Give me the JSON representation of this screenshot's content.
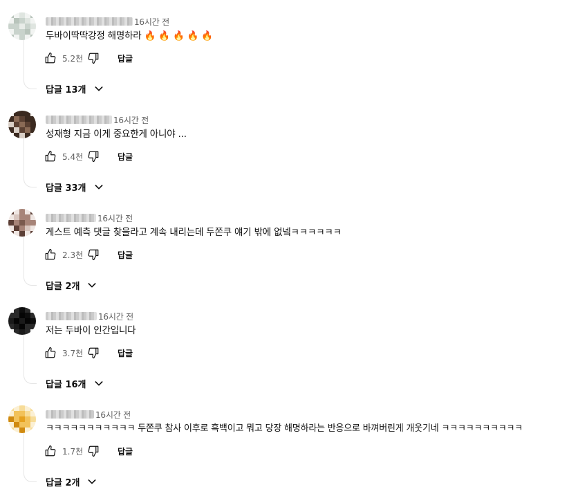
{
  "comments": [
    {
      "time": "16시간 전",
      "text": "두바이딱딱강정 해명하라 🔥 🔥 🔥 🔥 🔥",
      "likes": "5.2천",
      "reply_label": "답글",
      "replies_label": "답글 13개",
      "author_blur_width": 126,
      "avatar_palette": [
        "#e8ece8",
        "#c9d3cc",
        "#dfe5e0",
        "#b8c4bb",
        "#f2f4f2"
      ]
    },
    {
      "time": "16시간 전",
      "text": "성재형 지금 이게 중요한게 아니야 ...",
      "likes": "5.4천",
      "reply_label": "답글",
      "replies_label": "답글 33개",
      "author_blur_width": 96,
      "avatar_palette": [
        "#5a4032",
        "#8a6a55",
        "#d9cfc6",
        "#3b2a20",
        "#f0ece8"
      ]
    },
    {
      "time": "16시간 전",
      "text": "게스트 예측 댓글 찾을라고 계속 내리는데 두쫀쿠 얘기 밖에 없넼ㅋㅋㅋㅋㅋㅋ",
      "likes": "2.3천",
      "reply_label": "답글",
      "replies_label": "답글 2개",
      "author_blur_width": 73,
      "avatar_palette": [
        "#7a5a4e",
        "#a78478",
        "#d8c6bf",
        "#5c3f36",
        "#efe6e2"
      ]
    },
    {
      "time": "16시간 전",
      "text": "저는 두바이 인간입니다",
      "likes": "3.7천",
      "reply_label": "답글",
      "replies_label": "답글 16개",
      "author_blur_width": 74,
      "avatar_palette": [
        "#050505",
        "#1a1a1a",
        "#0d0d0d",
        "#2a2a2a",
        "#f5f5f5"
      ]
    },
    {
      "time": "16시간 전",
      "text": "ㅋㅋㅋㅋㅋㅋㅋㅋㅋㅋㅋ 두쫀쿠 참사 이후로 흑백이고 뭐고 당장 해명하라는 반응으로 바껴버린게 개웃기네 ㅋㅋㅋㅋㅋㅋㅋㅋㅋㅋ",
      "likes": "1.7천",
      "reply_label": "답글",
      "replies_label": "답글 2개",
      "author_blur_width": 70,
      "avatar_palette": [
        "#e6a11e",
        "#f2c25a",
        "#d08a10",
        "#f7dc98",
        "#fbf0d4"
      ]
    }
  ],
  "icons": {
    "like": "thumbs-up-icon",
    "dislike": "thumbs-down-icon",
    "expand": "chevron-down-icon"
  },
  "colors": {
    "secondary_text": "#606060",
    "primary_text": "#0f0f0f",
    "thread_line": "#e5e5e5"
  }
}
